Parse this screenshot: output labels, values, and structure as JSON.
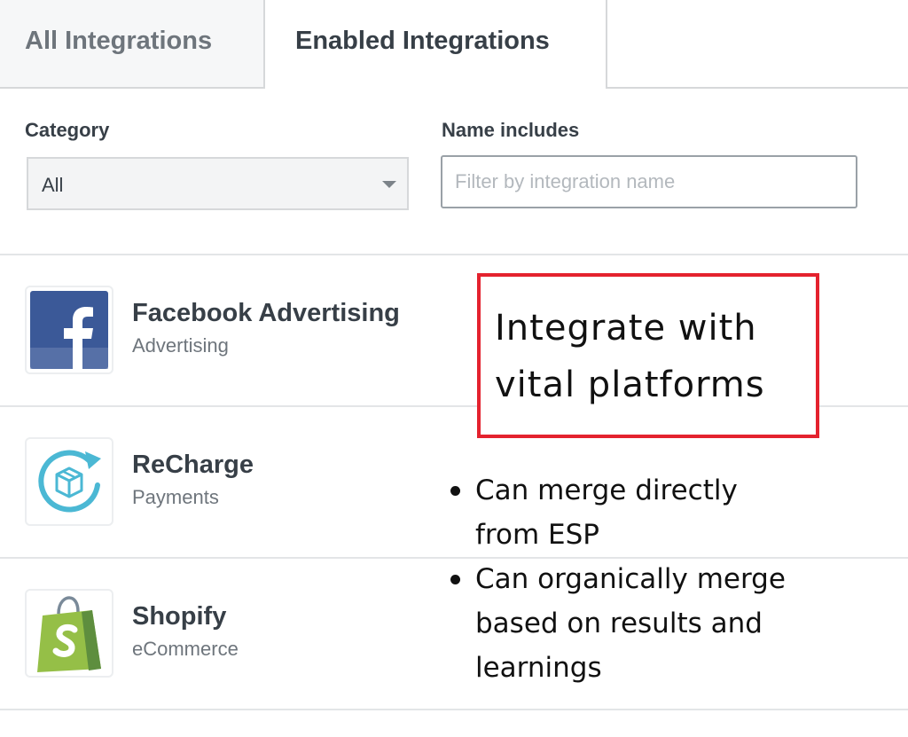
{
  "tabs": {
    "all_label": "All Integrations",
    "enabled_label": "Enabled Integrations"
  },
  "filters": {
    "category_label": "Category",
    "category_value": "All",
    "name_label": "Name includes",
    "name_placeholder": "Filter by integration name",
    "name_value": ""
  },
  "integrations": [
    {
      "name": "Facebook Advertising",
      "category": "Advertising",
      "icon": "facebook-icon",
      "color": "#3b5998"
    },
    {
      "name": "ReCharge",
      "category": "Payments",
      "icon": "recharge-icon",
      "color": "#4bb8d4"
    },
    {
      "name": "Shopify",
      "category": "eCommerce",
      "icon": "shopify-icon",
      "color": "#95bf47"
    }
  ],
  "annotation": {
    "callout_line1": "Integrate with",
    "callout_line2": "vital platforms",
    "bullet1_line1": "Can merge directly",
    "bullet1_line2": "from ESP",
    "bullet2_line1": "Can organically merge",
    "bullet2_line2": "based on results and",
    "bullet2_line3": "learnings",
    "border_color": "#e4222e"
  }
}
